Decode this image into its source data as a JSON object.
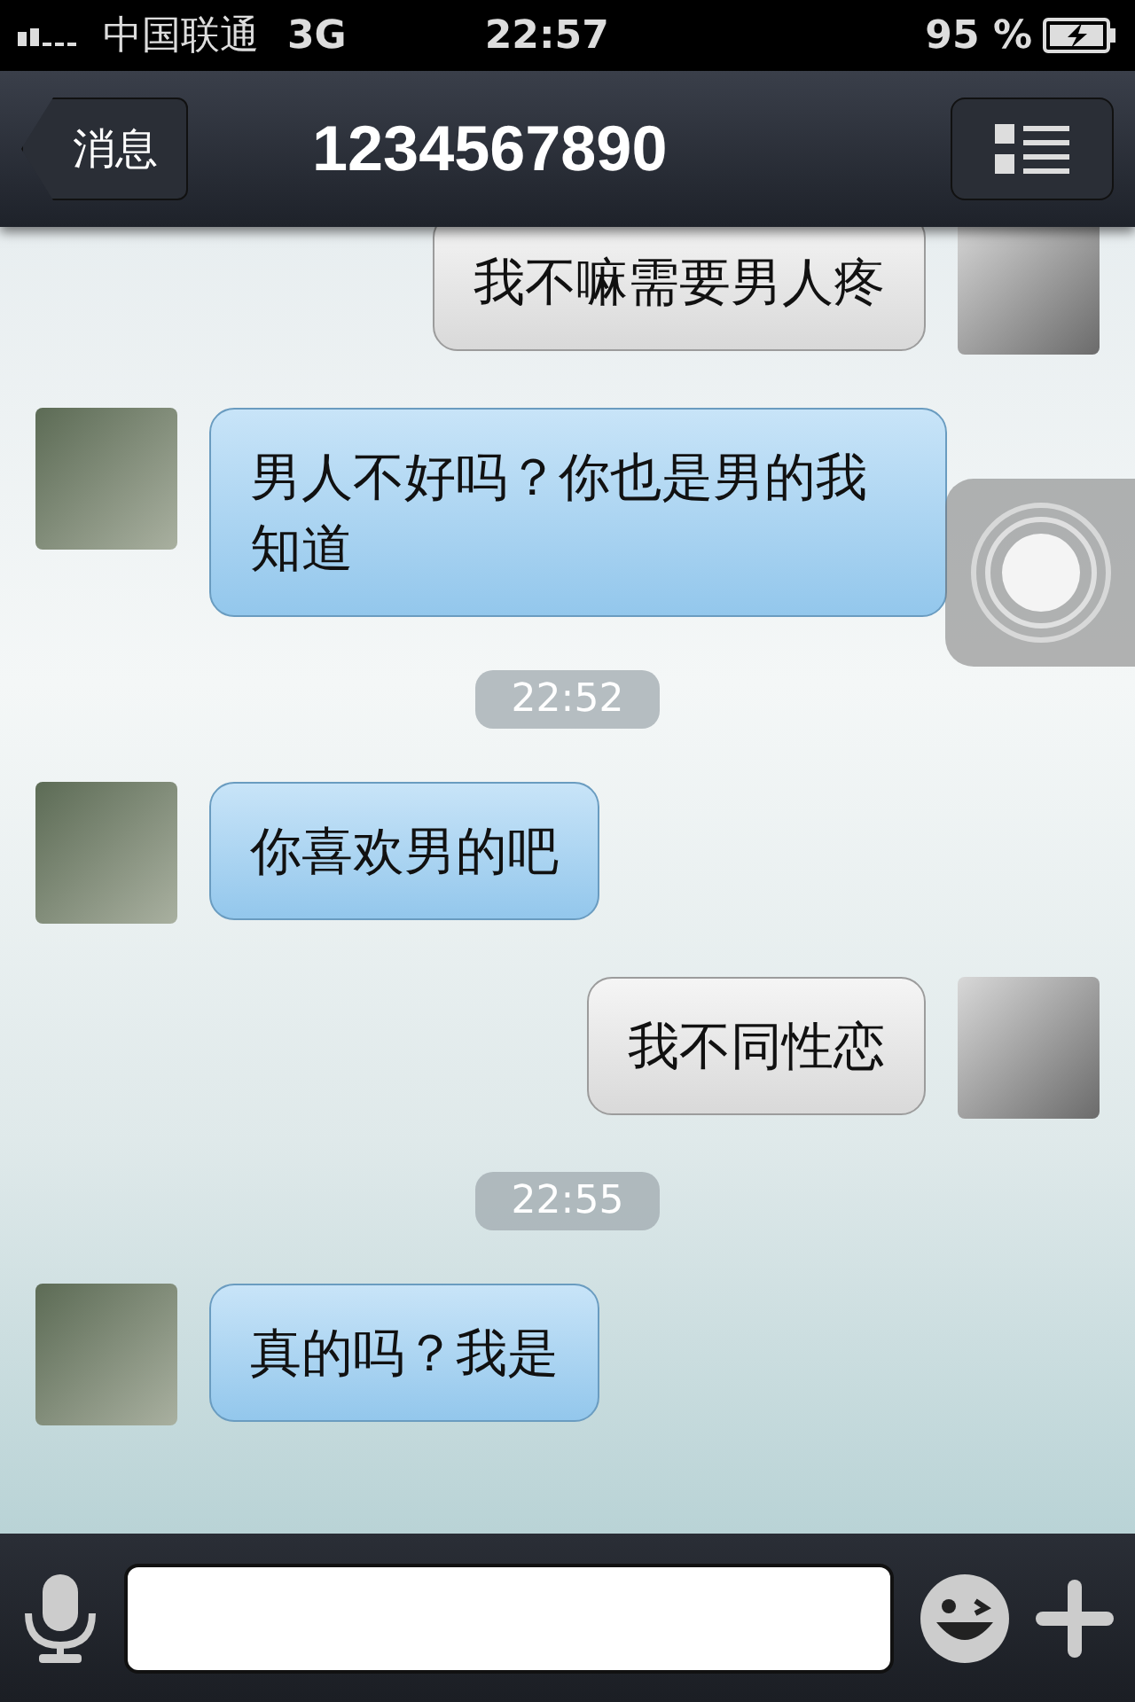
{
  "status_bar": {
    "carrier": "中国联通",
    "network": "3G",
    "time": "22:57",
    "battery": "95 %"
  },
  "nav": {
    "back": "消息",
    "title": "1234567890"
  },
  "messages": [
    {
      "kind": "out",
      "text": "我不嘛需要男人疼"
    },
    {
      "kind": "in",
      "text": "男人不好吗？你也是男的我知道"
    },
    {
      "kind": "time",
      "text": "22:52"
    },
    {
      "kind": "in",
      "text": "你喜欢男的吧"
    },
    {
      "kind": "out",
      "text": "我不同性恋"
    },
    {
      "kind": "time",
      "text": "22:55"
    },
    {
      "kind": "in",
      "text": "真的吗？我是"
    }
  ]
}
